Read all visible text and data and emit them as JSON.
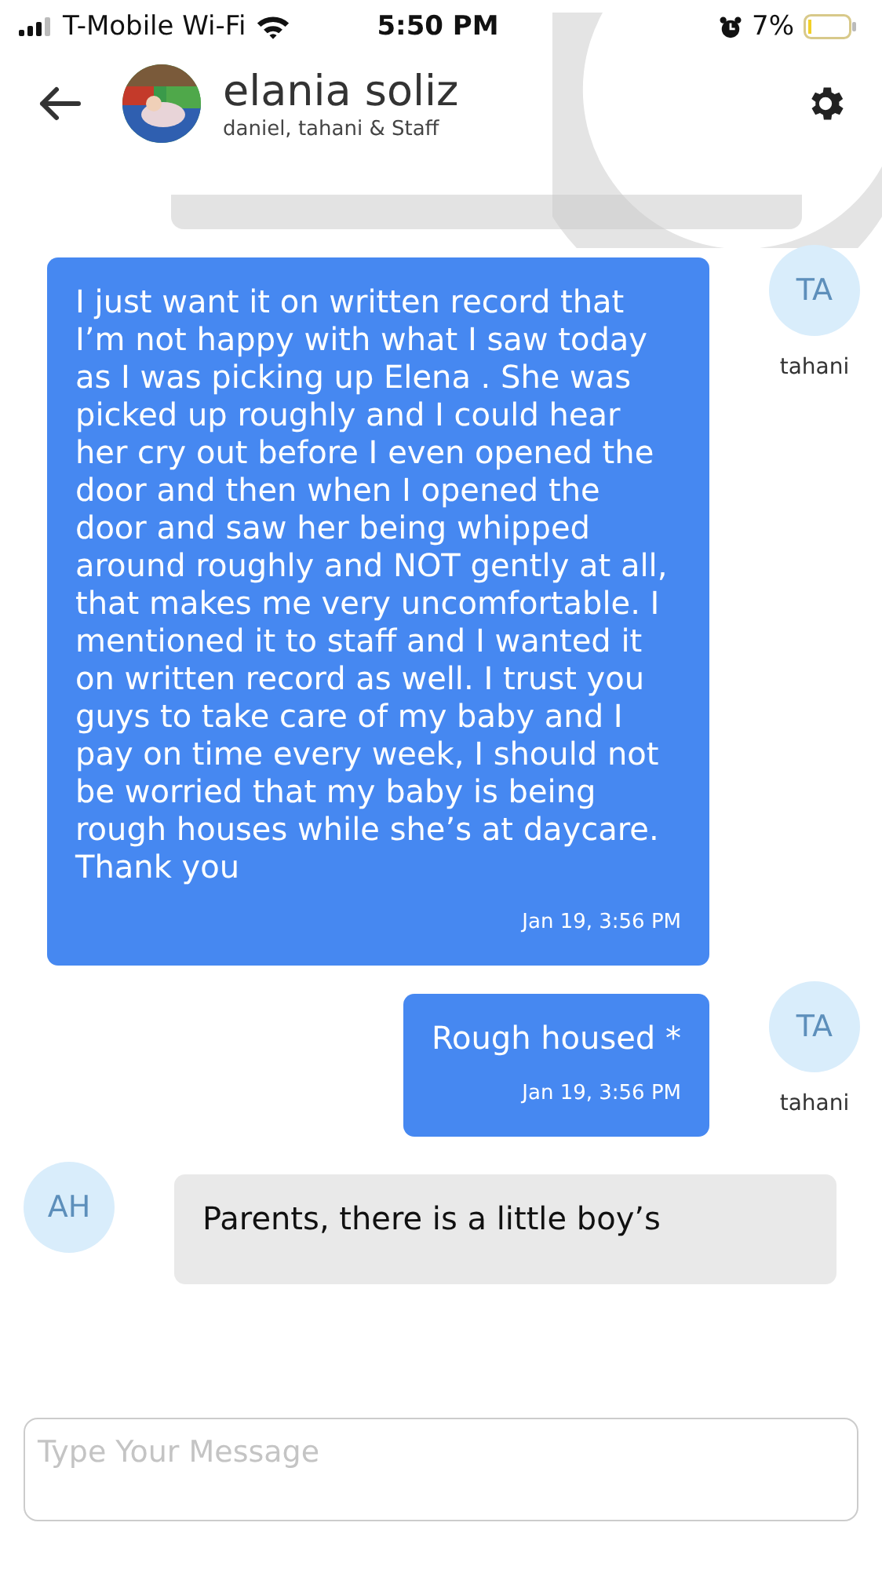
{
  "status_bar": {
    "carrier": "T-Mobile Wi-Fi",
    "time": "5:50 PM",
    "battery": "7%"
  },
  "header": {
    "title": "elania soliz",
    "subtitle": "daniel, tahani & Staff"
  },
  "messages": [
    {
      "kind": "placeholder"
    },
    {
      "kind": "outgoing",
      "text": "I just want it on written record that I’m not happy with what I saw today as I was picking up Elena . She was picked up roughly and I could hear her cry out before I even opened the door and then when I opened the door and saw her being whipped around roughly and NOT gently at all, that makes me very uncomfortable. I mentioned it to staff and I wanted it on written record as well. I trust you guys to take care of my baby and I pay on time every week, I should not be worried that my baby is being rough houses while she’s at daycare. Thank you",
      "time": "Jan 19, 3:56 PM",
      "initials": "TA",
      "sender": "tahani"
    },
    {
      "kind": "outgoing",
      "text": "Rough housed *",
      "time": "Jan 19, 3:56 PM",
      "initials": "TA",
      "sender": "tahani"
    },
    {
      "kind": "incoming",
      "text": "Parents, there is a little boy’s",
      "initials": "AH"
    }
  ],
  "composer": {
    "placeholder": "Type Your Message"
  }
}
